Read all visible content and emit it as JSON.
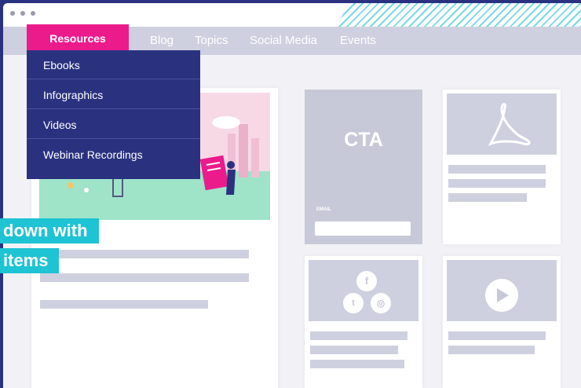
{
  "window": {
    "controls": [
      "close-dot",
      "minimize-dot",
      "maximize-dot"
    ]
  },
  "nav": {
    "active": "Resources",
    "items": [
      "Blog",
      "Topics",
      "Social Media",
      "Events"
    ]
  },
  "dropdown": {
    "items": [
      "Ebooks",
      "Infographics",
      "Videos",
      "Webinar Recordings"
    ]
  },
  "cta": {
    "title": "CTA",
    "email_label": "EMAIL"
  },
  "overlay": {
    "line1": "down with",
    "line2": "items"
  },
  "colors": {
    "navy": "#2a3280",
    "pink": "#ec1b8c",
    "teal": "#1ec3d4",
    "placeholder": "#cfd0df"
  },
  "icons": [
    "adobe-pdf-icon",
    "facebook-icon",
    "twitter-icon",
    "instagram-icon",
    "play-icon"
  ]
}
